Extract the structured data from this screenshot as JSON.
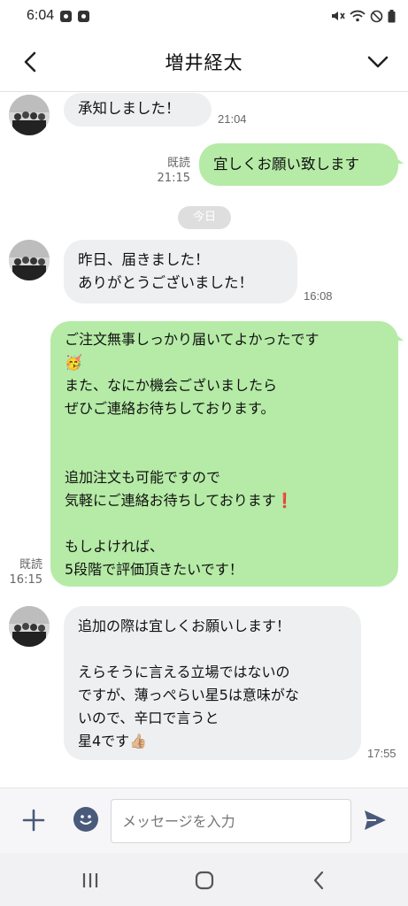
{
  "status_bar": {
    "time": "6:04"
  },
  "header": {
    "title": "増井経太"
  },
  "messages": [
    {
      "text": "承知しました！",
      "time": "21:04"
    },
    {
      "text": "宜しくお願い致します",
      "read": "既読",
      "time": "21:15"
    },
    {
      "text": "昨日、届きました！\nありがとうございました！",
      "time": "16:08"
    },
    {
      "text": "ご注文無事しっかり届いてよかったです\n🥳\nまた、なにか機会ございましたら\nぜひご連絡お待ちしております。\n\n\n追加注文も可能ですので\n気軽にご連絡お待ちしております❗️\n\nもしよければ、\n5段階で評価頂きたいです！",
      "read": "既読",
      "time": "16:15"
    },
    {
      "text": "追加の際は宜しくお願いします！\n\nえらそうに言える立場ではないの\nですが、薄っぺらい星5は意味がな\nいので、辛口で言うと\n星4です👍🏼",
      "time": "17:55"
    }
  ],
  "date_separator": "今日",
  "input": {
    "placeholder": "メッセージを入力"
  },
  "colors": {
    "outgoing_bubble": "#b5eba6",
    "incoming_bubble": "#eeeff1"
  },
  "icons": {
    "back": "chevron-left-icon",
    "menu": "chevron-down-icon",
    "plus": "plus-icon",
    "sticker": "emoji-icon",
    "send": "send-icon"
  }
}
